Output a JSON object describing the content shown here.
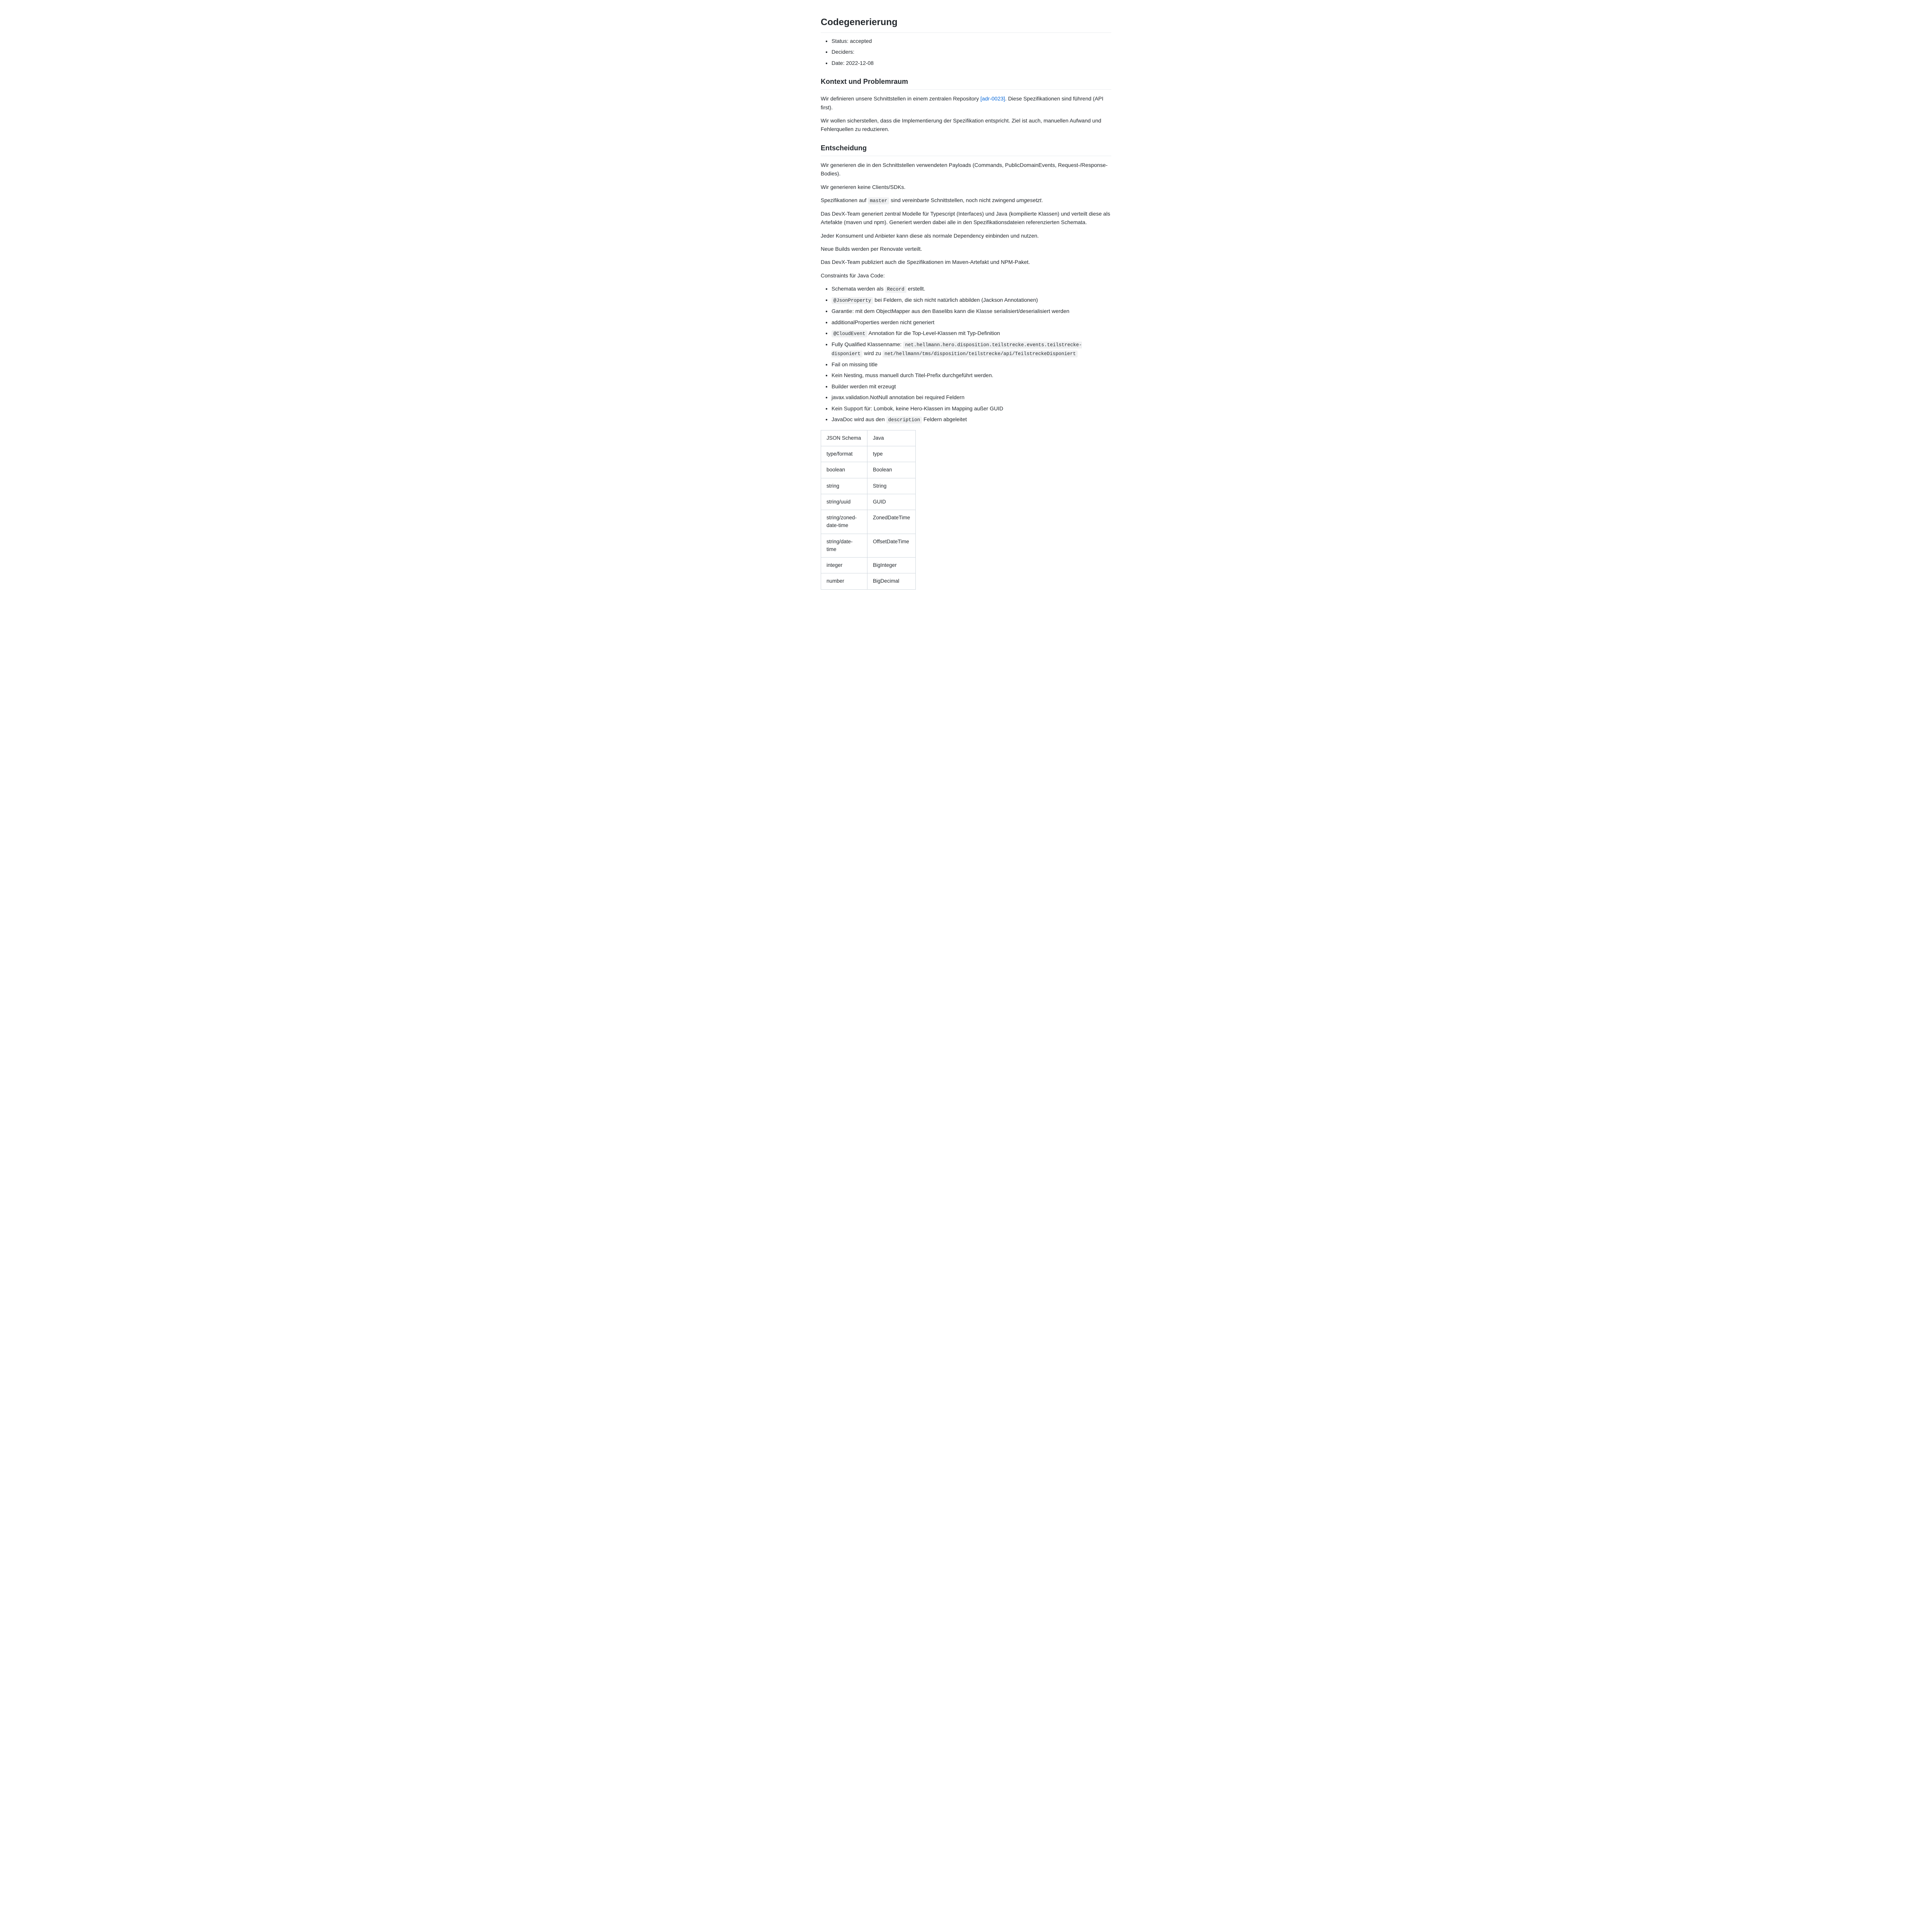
{
  "title": "Codegenerierung",
  "meta": {
    "status": "Status: accepted",
    "deciders": "Deciders:",
    "date": "Date: 2022-12-08"
  },
  "section_context": {
    "heading": "Kontext und Problemraum",
    "p1a": "Wir definieren unsere Schnittstellen in einem zentralen Repository ",
    "p1link": "[adr-0023]",
    "p1b": ". Diese Spezifikationen sind führend (API first).",
    "p2": "Wir wollen sicherstellen, dass die Implementierung der Spezifikation entspricht. Ziel ist auch, manuellen Aufwand und Fehlerquellen zu reduzieren."
  },
  "section_decision": {
    "heading": "Entscheidung",
    "p1": "Wir generieren die in den Schnittstellen verwendeten Payloads (Commands, PublicDomainEvents, Request-/Response-Bodies).",
    "p2": "Wir generieren keine Clients/SDKs.",
    "p3a": "Spezifikationen auf ",
    "p3code": "master",
    "p3b": " sind ",
    "p3em1": "vereinbarte",
    "p3c": " Schnittstellen, noch nicht zwingend ",
    "p3em2": "umgesetzt",
    "p3d": ".",
    "p4": "Das DevX-Team generiert zentral Modelle für Typescript (Interfaces) und Java (kompilierte Klassen) und verteilt diese als Artefakte (maven und npm). Generiert werden dabei alle in den Spezifikationsdateien referenzierten Schemata.",
    "p5": "Jeder Konsument und Anbieter kann diese als normale Dependency einbinden und nutzen.",
    "p6": "Neue Builds werden per Renovate verteilt.",
    "p7": "Das DevX-Team publiziert auch die Spezifikationen im Maven-Artefakt und NPM-Paket.",
    "p8": "Constraints für Java Code:"
  },
  "constraints": {
    "c1a": "Schemata werden als ",
    "c1code": "Record",
    "c1b": " erstellt.",
    "c2code": "@JsonProperty",
    "c2b": " bei Feldern, die sich nicht natürlich abbilden (Jackson Annotationen)",
    "c3": "Garantie: mit dem ObjectMapper aus den Baselibs kann die Klasse serialisiert/deserialisiert werden",
    "c4": "additionalProperties werden nicht generiert",
    "c5code": "@CloudEvent",
    "c5b": " Annotation für die Top-Level-Klassen mit Typ-Definition",
    "c6a": "Fully Qualified Klassenname: ",
    "c6code1": "net.hellmann.hero.disposition.teilstrecke.events.teilstrecke-disponiert",
    "c6b": " wird zu ",
    "c6code2": "net/hellmann/tms/disposition/teilstrecke/api/TeilstreckeDisponiert",
    "c7": "Fail on missing title",
    "c8": "Kein Nesting, muss manuell durch Titel-Prefix durchgeführt werden.",
    "c9": "Builder werden mit erzeugt",
    "c10": "javax.validation.NotNull annotation bei required Feldern",
    "c11": "Kein Support für: Lombok, keine Hero-Klassen im Mapping außer GUID",
    "c12a": "JavaDoc wird aus den ",
    "c12code": "description",
    "c12b": " Feldern abgeleitet"
  },
  "table": {
    "h1": "JSON Schema",
    "h2": "Java",
    "rows": [
      {
        "a": "type/format",
        "b": "type"
      },
      {
        "a": "boolean",
        "b": "Boolean"
      },
      {
        "a": "string",
        "b": "String"
      },
      {
        "a": "string/uuid",
        "b": "GUID"
      },
      {
        "a": "string/zoned-date-time",
        "b": "ZonedDateTime"
      },
      {
        "a": "string/date-time",
        "b": "OffsetDateTime"
      },
      {
        "a": "integer",
        "b": "BigInteger"
      },
      {
        "a": "number",
        "b": "BigDecimal"
      }
    ]
  }
}
